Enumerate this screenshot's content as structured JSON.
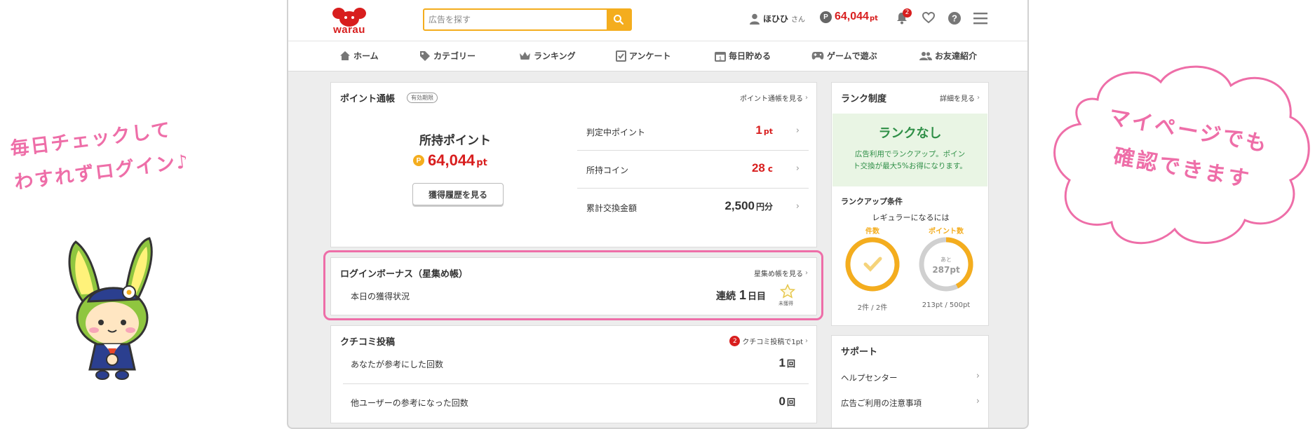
{
  "side": {
    "left_callout": [
      "毎日チェックして",
      "わすれずログイン♪"
    ],
    "right_callout": [
      "マイページでも",
      "確認できます"
    ]
  },
  "header": {
    "logo": "warau",
    "search_placeholder": "広告を探す",
    "user_name": "ほひひ",
    "user_suffix": "さん",
    "points_badge": "P",
    "points": "64,044",
    "points_unit": "pt",
    "notification_count": "2"
  },
  "nav": [
    {
      "label": "ホーム",
      "icon": "home-icon"
    },
    {
      "label": "カテゴリー",
      "icon": "tag-icon"
    },
    {
      "label": "ランキング",
      "icon": "crown-icon"
    },
    {
      "label": "アンケート",
      "icon": "survey-icon"
    },
    {
      "label": "毎日貯める",
      "icon": "calendar-icon"
    },
    {
      "label": "ゲームで遊ぶ",
      "icon": "gamepad-icon"
    },
    {
      "label": "お友達紹介",
      "icon": "friends-icon"
    }
  ],
  "passbook": {
    "title": "ポイント通帳",
    "badge": "有効期限",
    "link": "ポイント通帳を見る",
    "held_label": "所持ポイント",
    "held_value": "64,044",
    "held_unit": "pt",
    "history_button": "獲得履歴を見る",
    "rows": [
      {
        "label": "判定中ポイント",
        "value": "1",
        "unit": "pt"
      },
      {
        "label": "所持コイン",
        "value": "28",
        "unit": "c"
      },
      {
        "label": "累計交換金額",
        "value": "2,500",
        "unit": "円分"
      }
    ]
  },
  "login_bonus": {
    "title": "ログインボーナス（星集め帳）",
    "link": "星集め帳を見る",
    "status_label": "本日の獲得状況",
    "streak_prefix": "連続",
    "streak_value": "1",
    "streak_suffix": "日目",
    "star_label": "未獲得"
  },
  "review": {
    "title": "クチコミ投稿",
    "badge_count": "2",
    "link": "クチコミ投稿で1pt",
    "rows": [
      {
        "label": "あなたが参考にした回数",
        "value": "1",
        "unit": "回"
      },
      {
        "label": "他ユーザーの参考になった回数",
        "value": "0",
        "unit": "回"
      }
    ]
  },
  "rank": {
    "title": "ランク制度",
    "link": "詳細を見る",
    "status": "ランクなし",
    "desc": [
      "広告利用でランクアップ。ポイン",
      "ト交換が最大5%お得になります。"
    ],
    "condition_title": "ランクアップ条件",
    "condition_sub": "レギュラーになるには",
    "ring1": {
      "label": "件数",
      "caption": "2件 / 2件",
      "progress": 1.0
    },
    "ring2": {
      "label": "ポイント数",
      "inner_small": "あと",
      "inner_big": "287pt",
      "caption": "213pt / 500pt",
      "progress": 0.426
    }
  },
  "support": {
    "title": "サポート",
    "items": [
      "ヘルプセンター",
      "広告ご利用の注意事項"
    ]
  },
  "colors": {
    "accent_orange": "#f4ad1e",
    "brand_red": "#d81e1e",
    "highlight_pink": "#ee6ea8",
    "rank_green": "#2f8f47"
  }
}
